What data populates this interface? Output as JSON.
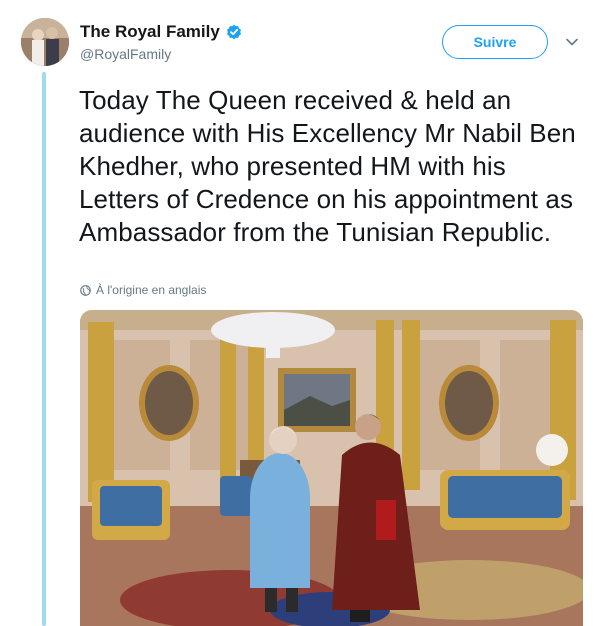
{
  "tweet": {
    "author": {
      "display_name": "The Royal Family",
      "handle": "@RoyalFamily",
      "verified": true,
      "avatar_icon": "avatar-photo"
    },
    "follow_label": "Suivre",
    "menu_icon": "chevron-down-icon",
    "text": "Today The Queen received & held an audience with His Excellency Mr Nabil Ben Khedher, who presented HM with his Letters of Credence on his appointment as Ambassador from the Tunisian Republic.",
    "translation_note": "À l'origine en anglais",
    "translation_icon": "globe-icon",
    "media": {
      "type": "photo",
      "subject": "queen-receiving-ambassador"
    }
  },
  "colors": {
    "accent": "#1da1f2",
    "thread_line": "#a2d8f2",
    "secondary_text": "#657786",
    "primary_text": "#14171a"
  }
}
